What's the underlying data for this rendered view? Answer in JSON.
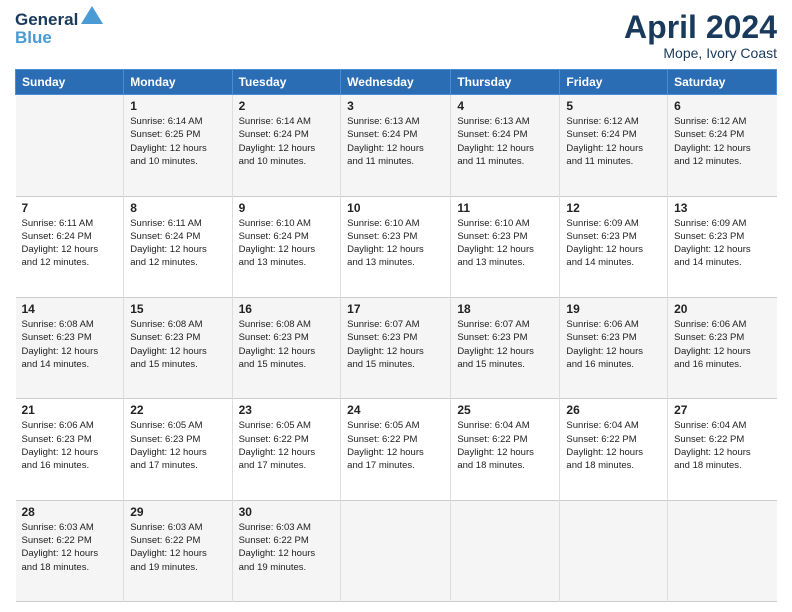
{
  "logo": {
    "line1": "General",
    "line2": "Blue"
  },
  "title": "April 2024",
  "location": "Mope, Ivory Coast",
  "days_of_week": [
    "Sunday",
    "Monday",
    "Tuesday",
    "Wednesday",
    "Thursday",
    "Friday",
    "Saturday"
  ],
  "weeks": [
    [
      {
        "day": "",
        "info": ""
      },
      {
        "day": "1",
        "info": "Sunrise: 6:14 AM\nSunset: 6:25 PM\nDaylight: 12 hours\nand 10 minutes."
      },
      {
        "day": "2",
        "info": "Sunrise: 6:14 AM\nSunset: 6:24 PM\nDaylight: 12 hours\nand 10 minutes."
      },
      {
        "day": "3",
        "info": "Sunrise: 6:13 AM\nSunset: 6:24 PM\nDaylight: 12 hours\nand 11 minutes."
      },
      {
        "day": "4",
        "info": "Sunrise: 6:13 AM\nSunset: 6:24 PM\nDaylight: 12 hours\nand 11 minutes."
      },
      {
        "day": "5",
        "info": "Sunrise: 6:12 AM\nSunset: 6:24 PM\nDaylight: 12 hours\nand 11 minutes."
      },
      {
        "day": "6",
        "info": "Sunrise: 6:12 AM\nSunset: 6:24 PM\nDaylight: 12 hours\nand 12 minutes."
      }
    ],
    [
      {
        "day": "7",
        "info": "Sunrise: 6:11 AM\nSunset: 6:24 PM\nDaylight: 12 hours\nand 12 minutes."
      },
      {
        "day": "8",
        "info": "Sunrise: 6:11 AM\nSunset: 6:24 PM\nDaylight: 12 hours\nand 12 minutes."
      },
      {
        "day": "9",
        "info": "Sunrise: 6:10 AM\nSunset: 6:24 PM\nDaylight: 12 hours\nand 13 minutes."
      },
      {
        "day": "10",
        "info": "Sunrise: 6:10 AM\nSunset: 6:23 PM\nDaylight: 12 hours\nand 13 minutes."
      },
      {
        "day": "11",
        "info": "Sunrise: 6:10 AM\nSunset: 6:23 PM\nDaylight: 12 hours\nand 13 minutes."
      },
      {
        "day": "12",
        "info": "Sunrise: 6:09 AM\nSunset: 6:23 PM\nDaylight: 12 hours\nand 14 minutes."
      },
      {
        "day": "13",
        "info": "Sunrise: 6:09 AM\nSunset: 6:23 PM\nDaylight: 12 hours\nand 14 minutes."
      }
    ],
    [
      {
        "day": "14",
        "info": "Sunrise: 6:08 AM\nSunset: 6:23 PM\nDaylight: 12 hours\nand 14 minutes."
      },
      {
        "day": "15",
        "info": "Sunrise: 6:08 AM\nSunset: 6:23 PM\nDaylight: 12 hours\nand 15 minutes."
      },
      {
        "day": "16",
        "info": "Sunrise: 6:08 AM\nSunset: 6:23 PM\nDaylight: 12 hours\nand 15 minutes."
      },
      {
        "day": "17",
        "info": "Sunrise: 6:07 AM\nSunset: 6:23 PM\nDaylight: 12 hours\nand 15 minutes."
      },
      {
        "day": "18",
        "info": "Sunrise: 6:07 AM\nSunset: 6:23 PM\nDaylight: 12 hours\nand 15 minutes."
      },
      {
        "day": "19",
        "info": "Sunrise: 6:06 AM\nSunset: 6:23 PM\nDaylight: 12 hours\nand 16 minutes."
      },
      {
        "day": "20",
        "info": "Sunrise: 6:06 AM\nSunset: 6:23 PM\nDaylight: 12 hours\nand 16 minutes."
      }
    ],
    [
      {
        "day": "21",
        "info": "Sunrise: 6:06 AM\nSunset: 6:23 PM\nDaylight: 12 hours\nand 16 minutes."
      },
      {
        "day": "22",
        "info": "Sunrise: 6:05 AM\nSunset: 6:23 PM\nDaylight: 12 hours\nand 17 minutes."
      },
      {
        "day": "23",
        "info": "Sunrise: 6:05 AM\nSunset: 6:22 PM\nDaylight: 12 hours\nand 17 minutes."
      },
      {
        "day": "24",
        "info": "Sunrise: 6:05 AM\nSunset: 6:22 PM\nDaylight: 12 hours\nand 17 minutes."
      },
      {
        "day": "25",
        "info": "Sunrise: 6:04 AM\nSunset: 6:22 PM\nDaylight: 12 hours\nand 18 minutes."
      },
      {
        "day": "26",
        "info": "Sunrise: 6:04 AM\nSunset: 6:22 PM\nDaylight: 12 hours\nand 18 minutes."
      },
      {
        "day": "27",
        "info": "Sunrise: 6:04 AM\nSunset: 6:22 PM\nDaylight: 12 hours\nand 18 minutes."
      }
    ],
    [
      {
        "day": "28",
        "info": "Sunrise: 6:03 AM\nSunset: 6:22 PM\nDaylight: 12 hours\nand 18 minutes."
      },
      {
        "day": "29",
        "info": "Sunrise: 6:03 AM\nSunset: 6:22 PM\nDaylight: 12 hours\nand 19 minutes."
      },
      {
        "day": "30",
        "info": "Sunrise: 6:03 AM\nSunset: 6:22 PM\nDaylight: 12 hours\nand 19 minutes."
      },
      {
        "day": "",
        "info": ""
      },
      {
        "day": "",
        "info": ""
      },
      {
        "day": "",
        "info": ""
      },
      {
        "day": "",
        "info": ""
      }
    ]
  ]
}
